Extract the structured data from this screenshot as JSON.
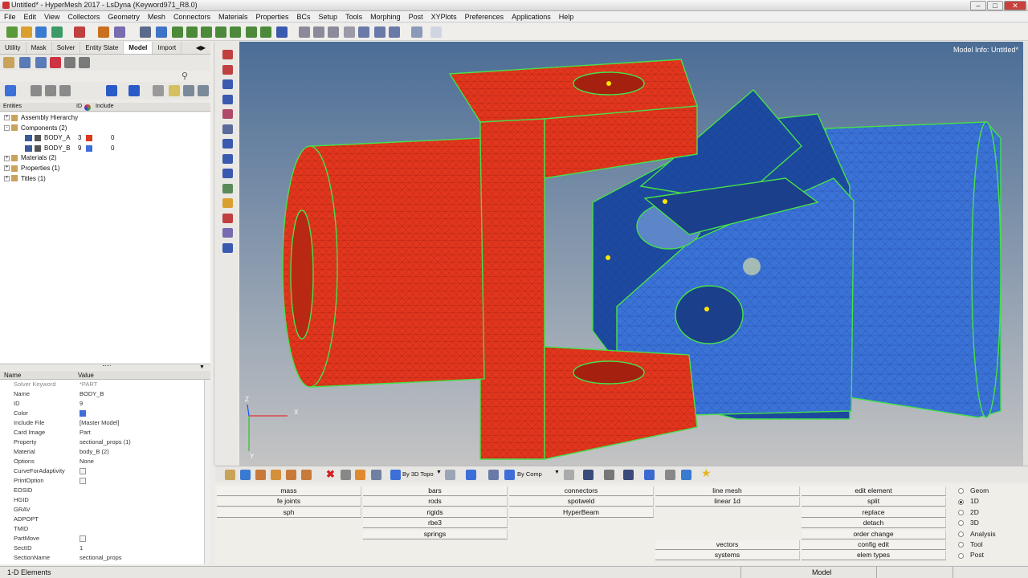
{
  "window": {
    "title": "Untitled* - HyperMesh 2017 - LsDyna (Keyword971_R8.0)",
    "min": "–",
    "max": "□",
    "close": "✕"
  },
  "menu": [
    "File",
    "Edit",
    "View",
    "Collectors",
    "Geometry",
    "Mesh",
    "Connectors",
    "Materials",
    "Properties",
    "BCs",
    "Setup",
    "Tools",
    "Morphing",
    "Post",
    "XYPlots",
    "Preferences",
    "Applications",
    "Help"
  ],
  "left_tabs": [
    "Utility",
    "Mask",
    "Solver",
    "Entity State",
    "Model",
    "Import"
  ],
  "active_tab": "Model",
  "entity_header": {
    "entities": "Entities",
    "id": "ID",
    "include": "Include"
  },
  "tree": [
    {
      "label": "Assembly Hierarchy",
      "indent": 0,
      "expander": "+"
    },
    {
      "label": "Components (2)",
      "indent": 0,
      "expander": "-"
    },
    {
      "label": "BODY_A",
      "indent": 1,
      "id": "3",
      "color": "#d83a1e",
      "include": "0"
    },
    {
      "label": "BODY_B",
      "indent": 1,
      "id": "9",
      "color": "#3d6fd8",
      "include": "0"
    },
    {
      "label": "Materials (2)",
      "indent": 0,
      "expander": "+"
    },
    {
      "label": "Properties (1)",
      "indent": 0,
      "expander": "+"
    },
    {
      "label": "Titles (1)",
      "indent": 0,
      "expander": "+"
    }
  ],
  "prop_header": {
    "name": "Name",
    "value": "Value"
  },
  "props": [
    {
      "name": "Solver Keyword",
      "value": "*PART",
      "gray": true
    },
    {
      "name": "Name",
      "value": "BODY_B"
    },
    {
      "name": "ID",
      "value": "9"
    },
    {
      "name": "Color",
      "value": "",
      "swatch": "#3d6fd8"
    },
    {
      "name": "Include File",
      "value": "[Master Model]"
    },
    {
      "name": "Card Image",
      "value": "Part"
    },
    {
      "name": "Property",
      "value": "sectional_props (1)"
    },
    {
      "name": "Material",
      "value": "body_B (2)"
    },
    {
      "name": "Options",
      "value": "None"
    },
    {
      "name": "CurveForAdaptivity",
      "value": "",
      "check": true
    },
    {
      "name": "PrintOption",
      "value": "",
      "check": true
    },
    {
      "name": "EOSID",
      "value": ""
    },
    {
      "name": "HGID",
      "value": ""
    },
    {
      "name": "GRAV",
      "value": ""
    },
    {
      "name": "ADPOPT",
      "value": ""
    },
    {
      "name": "TMID",
      "value": ""
    },
    {
      "name": "PartMove",
      "value": "",
      "check": true
    },
    {
      "name": "SectID",
      "value": "1"
    },
    {
      "name": "SectionName",
      "value": "sectional_props"
    }
  ],
  "viewport": {
    "model_info": "Model Info: Untitled*",
    "axis_z": "Z",
    "axis_x": "X",
    "axis_y": "Y"
  },
  "viewtoolbar": {
    "topo": "By 3D Topo",
    "comp": "By Comp"
  },
  "panel": {
    "col1": [
      "mass",
      "fe joints",
      "sph"
    ],
    "col2": [
      "bars",
      "rods",
      "rigids",
      "rbe3",
      "springs"
    ],
    "col3": [
      "connectors",
      "spotweld",
      "HyperBeam"
    ],
    "col4": [
      "line mesh",
      "linear 1d",
      "",
      "",
      "",
      "vectors",
      "systems"
    ],
    "col5": [
      "edit element",
      "split",
      "replace",
      "detach",
      "order change",
      "config edit",
      "elem types"
    ]
  },
  "radios": [
    "Geom",
    "1D",
    "2D",
    "3D",
    "Analysis",
    "Tool",
    "Post"
  ],
  "radio_selected": "1D",
  "status": {
    "left": "1-D Elements",
    "model": "Model"
  }
}
